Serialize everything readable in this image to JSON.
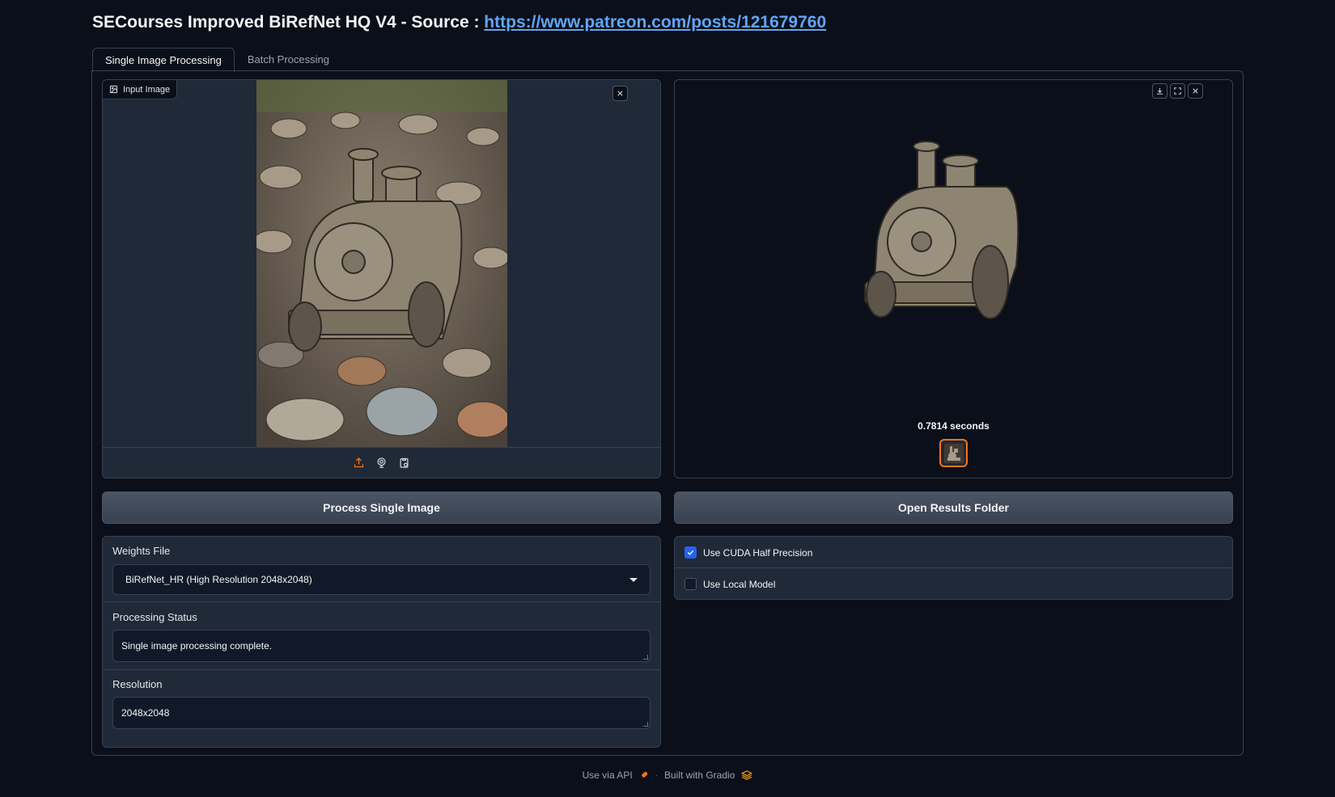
{
  "header": {
    "title": "SECourses Improved BiRefNet HQ V4 - Source : ",
    "source_link": "https://www.patreon.com/posts/121679760"
  },
  "tabs": [
    {
      "label": "Single Image Processing",
      "active": true
    },
    {
      "label": "Batch Processing",
      "active": false
    }
  ],
  "input_image": {
    "label": "Input Image",
    "source_icons": [
      "upload-icon",
      "webcam-icon",
      "clipboard-icon"
    ]
  },
  "output_image": {
    "caption": "0.7814 seconds",
    "toolbar_icons": [
      "download-icon",
      "fullscreen-icon",
      "close-icon"
    ]
  },
  "buttons": {
    "process": "Process Single Image",
    "open_folder": "Open Results Folder"
  },
  "settings": {
    "weights_label": "Weights File",
    "weights_value": "BiRefNet_HR (High Resolution 2048x2048)",
    "status_label": "Processing Status",
    "status_value": "Single image processing complete.",
    "resolution_label": "Resolution",
    "resolution_value": "2048x2048"
  },
  "options": {
    "cuda_half_label": "Use CUDA Half Precision",
    "cuda_half_checked": true,
    "local_model_label": "Use Local Model",
    "local_model_checked": false
  },
  "footer": {
    "api": "Use via API",
    "separator": "·",
    "built_with": "Built with Gradio"
  },
  "colors": {
    "background": "#0b0f19",
    "panel": "#1f2937",
    "border": "#374151",
    "accent_orange": "#f97316",
    "checkbox_blue": "#2563eb",
    "link_blue": "#60a5fa"
  }
}
